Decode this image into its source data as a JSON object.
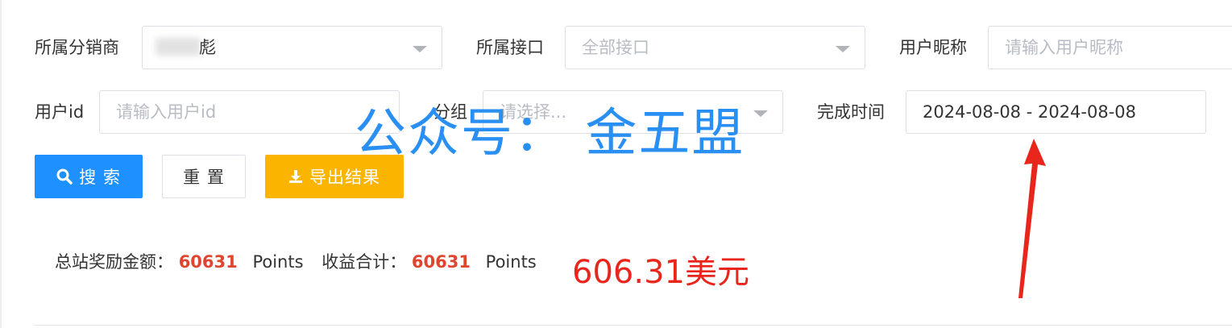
{
  "filters": {
    "distributor": {
      "label": "所属分销商",
      "value": "彪"
    },
    "interface": {
      "label": "所属接口",
      "value": "全部接口"
    },
    "nickname": {
      "label": "用户昵称",
      "placeholder": "请输入用户昵称"
    },
    "user_id": {
      "label": "用户id",
      "placeholder": "请输入用户id"
    },
    "group": {
      "label": "分组",
      "placeholder": "请选择..."
    },
    "finish_time": {
      "label": "完成时间",
      "value": "2024-08-08 - 2024-08-08"
    }
  },
  "actions": {
    "search_label": "搜 索",
    "reset_label": "重 置",
    "export_label": "导出结果"
  },
  "summary": {
    "total_reward_label": "总站奖励金额：",
    "total_reward_value": "60631",
    "total_reward_unit": "Points",
    "income_label": "收益合计：",
    "income_value": "60631",
    "income_unit": "Points"
  },
  "overlays": {
    "watermark": "公众号：  金五盟",
    "annotation": "606.31美元"
  },
  "colors": {
    "primary": "#1e90ff",
    "warning": "#fbb400",
    "highlight_number": "#e0452f",
    "annotation": "#e8261c",
    "watermark": "#2a8ff3"
  },
  "icons": {
    "search_button": "search-icon",
    "export_button": "download-icon",
    "select": "chevron-down-icon"
  }
}
